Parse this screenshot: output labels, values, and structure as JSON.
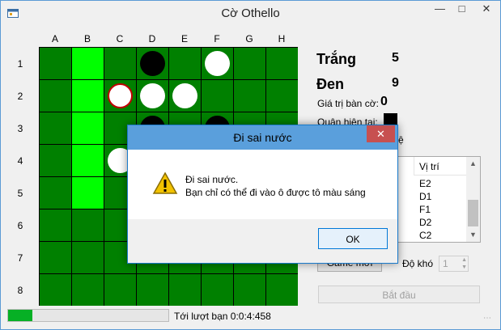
{
  "window": {
    "title": "Cờ Othello"
  },
  "board": {
    "columns": [
      "A",
      "B",
      "C",
      "D",
      "E",
      "F",
      "G",
      "H"
    ],
    "rows": [
      "1",
      "2",
      "3",
      "4",
      "5",
      "6",
      "7",
      "8"
    ],
    "colors": {
      "dark": "#008000",
      "highlight": "#00ff00",
      "line": "#000000",
      "last_move_ring": "#c00000"
    },
    "highlighted_cells": [
      "B1",
      "B2",
      "B3",
      "B4",
      "B5"
    ],
    "discs": [
      {
        "cell": "D1",
        "color": "black"
      },
      {
        "cell": "F1",
        "color": "white"
      },
      {
        "cell": "C2",
        "color": "white",
        "last_move": true
      },
      {
        "cell": "D2",
        "color": "white"
      },
      {
        "cell": "E2",
        "color": "white"
      },
      {
        "cell": "D3",
        "color": "black"
      },
      {
        "cell": "F3",
        "color": "black"
      },
      {
        "cell": "C4",
        "color": "white"
      }
    ]
  },
  "scores": {
    "white_label": "Trắng",
    "white_value": "5",
    "black_label": "Đen",
    "black_value": "9"
  },
  "board_value": {
    "label": "Giá trị bàn cờ:",
    "value": "0"
  },
  "current_player": {
    "label": "Quân hiện tại:",
    "color": "black"
  },
  "hint_fragment": "ệ",
  "history": {
    "column_header": "Vị trí",
    "items": [
      "E2",
      "D1",
      "F1",
      "D2",
      "C2"
    ]
  },
  "controls": {
    "new_game_label": "Game mới",
    "difficulty_label": "Độ khó",
    "difficulty_value": "1",
    "start_label": "Bắt đầu"
  },
  "status": {
    "progress": 0.15,
    "text": "Tới lượt bạn   0:0:4:458"
  },
  "dialog": {
    "title": "Đi sai nước",
    "message_line1": "Đi sai nước.",
    "message_line2": "Bạn chỉ có thể đi vào ô được tô màu sáng",
    "ok_label": "OK"
  }
}
